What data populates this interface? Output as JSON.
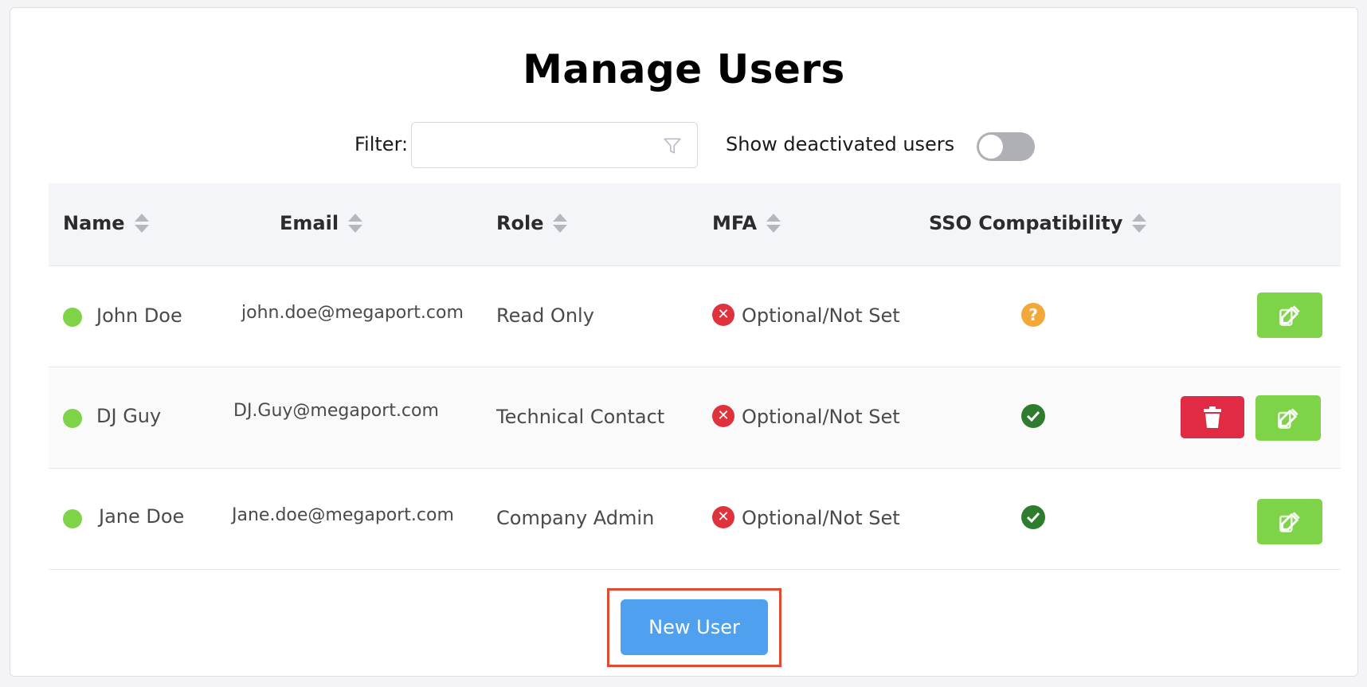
{
  "page": {
    "title": "Manage Users"
  },
  "filter": {
    "label": "Filter:",
    "value": "",
    "placeholder": ""
  },
  "toggle": {
    "label": "Show deactivated users",
    "on": false
  },
  "table": {
    "columns": [
      "Name",
      "Email",
      "Role",
      "MFA",
      "SSO Compatibility"
    ],
    "rows": [
      {
        "name": "John Doe",
        "email": "john.doe@megaport.com",
        "role": "Read Only",
        "mfa": "Optional/Not Set",
        "sso": "unknown",
        "status": "active",
        "can_delete": false
      },
      {
        "name": "DJ Guy",
        "email": "DJ.Guy@megaport.com",
        "role": "Technical Contact",
        "mfa": "Optional/Not Set",
        "sso": "compatible",
        "status": "active",
        "can_delete": true
      },
      {
        "name": "Jane Doe",
        "email": "Jane.doe@megaport.com",
        "role": "Company Admin",
        "mfa": "Optional/Not Set",
        "sso": "compatible",
        "status": "active",
        "can_delete": false
      }
    ]
  },
  "actions": {
    "new_user_label": "New User"
  },
  "colors": {
    "active_dot": "#7ed348",
    "edit_button": "#7ed348",
    "delete_button": "#e12a44",
    "mfa_missing": "#e0323d",
    "sso_unknown": "#f3a83a",
    "sso_ok": "#2e7d2e",
    "primary_button": "#4fa0ee",
    "highlight_frame": "#e24b2f"
  },
  "icons": {
    "filter": "filter-icon",
    "sort": "sort-icon",
    "status": "status-dot-icon",
    "mfa": "x-circle-icon",
    "sso_unknown": "question-circle-icon",
    "sso_ok": "check-circle-icon",
    "edit": "edit-icon",
    "delete": "trash-icon"
  }
}
